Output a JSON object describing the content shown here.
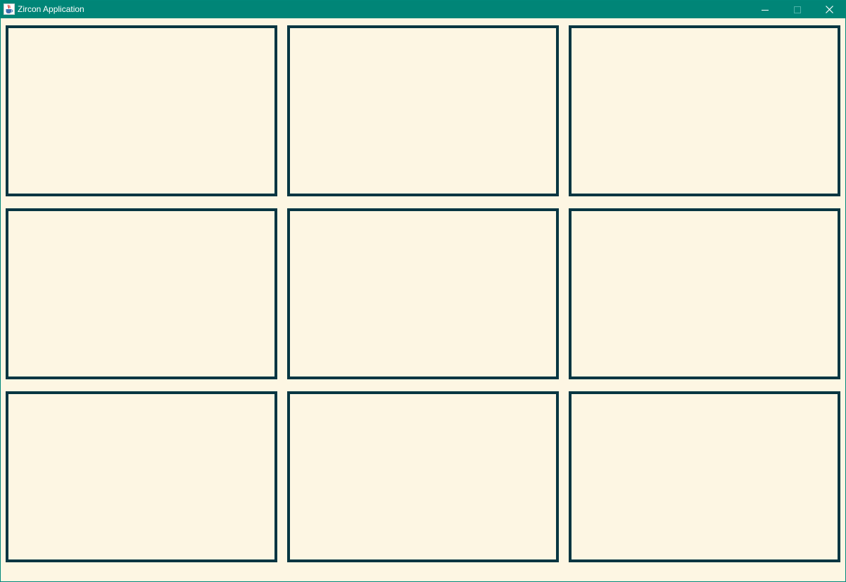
{
  "window": {
    "title": "Zircon Application",
    "controls": [
      "minimize",
      "maximize",
      "close"
    ]
  },
  "icons": {
    "app": "java-cup-icon",
    "minimize": "minimize-icon",
    "maximize": "maximize-icon",
    "close": "close-icon"
  },
  "colors": {
    "titlebar": "#008577",
    "background": "#fdf6e3",
    "panel_border": "#073642"
  },
  "panels": {
    "rows": 3,
    "columns": 3,
    "count": 9
  }
}
